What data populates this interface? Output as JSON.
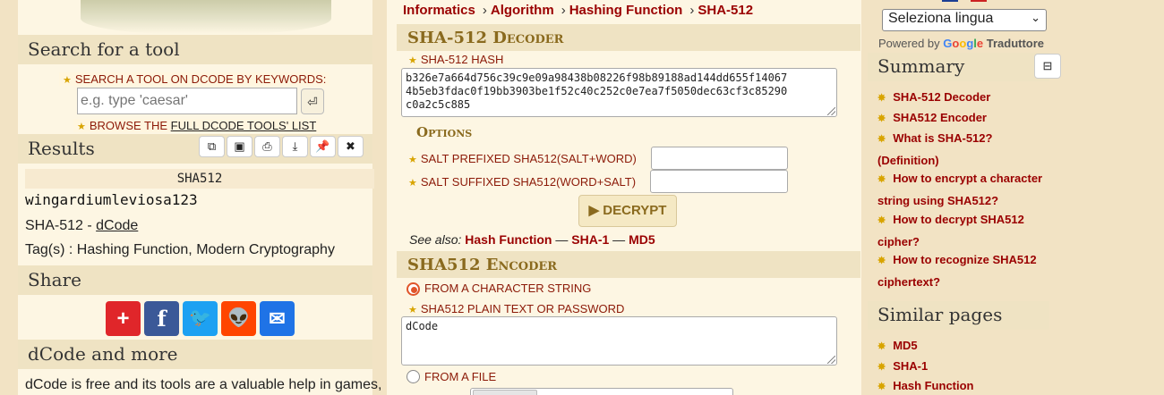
{
  "left": {
    "search_header": "Search for a tool",
    "kw_label": "SEARCH A TOOL ON DCODE BY KEYWORDS:",
    "search_placeholder": "e.g. type 'caesar'",
    "enter_glyph": "⏎",
    "browse_prefix": "BROWSE THE ",
    "browse_link": "FULL DCODE TOOLS' LIST",
    "results_header": "Results",
    "result_tools": [
      "copy-icon",
      "save-icon",
      "print-icon",
      "download-icon",
      "pin-icon",
      "close-icon"
    ],
    "result_label": "SHA512",
    "result_value": "wingardiumleviosa123",
    "source_prefix": "SHA-512 - ",
    "source_link": "dCode",
    "tags": "Tag(s) : Hashing Function, Modern Cryptography",
    "share_header": "Share",
    "share_buttons": [
      {
        "name": "addthis",
        "glyph": "+",
        "color": "#e0262a"
      },
      {
        "name": "facebook",
        "glyph": "f",
        "color": "#3b5998"
      },
      {
        "name": "twitter",
        "glyph": "🐦",
        "color": "#1da1f2"
      },
      {
        "name": "reddit",
        "glyph": "👽",
        "color": "#ff4500"
      },
      {
        "name": "email",
        "glyph": "✉",
        "color": "#1f73e6"
      }
    ],
    "more_header": "dCode and more",
    "more_text": "dCode is free and its tools are a valuable help in games,"
  },
  "middle": {
    "breadcrumb": [
      "Informatics",
      "Algorithm",
      "Hashing Function",
      "SHA-512"
    ],
    "decoder_title": "SHA-512 Decoder",
    "hash_label": "SHA-512 HASH",
    "hash_value": "b326e7a664d756c39c9e09a98438b08226f98b89188ad144dd655f14067\n4b5eb3fdac0f19bb3903be1f52c40c252c0e7ea7f5050dec63cf3c85290\nc0a2c5c885",
    "options_title": "Options",
    "salt_prefixed": "SALT PREFIXED SHA512(SALT+WORD)",
    "salt_suffixed": "SALT SUFFIXED SHA512(WORD+SALT)",
    "decrypt_label": "▶ DECRYPT",
    "see_also_prefix": "See also: ",
    "see_also": [
      "Hash Function",
      "SHA-1",
      "MD5"
    ],
    "encoder_title": "SHA512 Encoder",
    "from_string": "FROM A CHARACTER STRING",
    "plain_label": "SHA512 PLAIN TEXT OR PASSWORD",
    "plain_value": "dCode",
    "from_file": "FROM A FILE"
  },
  "right": {
    "language": "Seleziona lingua",
    "powered_by": "Powered by",
    "google": "Google",
    "translate": "Traduttore",
    "summary_header": "Summary",
    "summary_items": [
      "SHA-512 Decoder",
      "SHA512 Encoder",
      "What is SHA-512? (Definition)",
      "How to encrypt a character string using SHA512?",
      "How to decrypt SHA512 cipher?",
      "How to recognize SHA512 ciphertext?"
    ],
    "similar_header": "Similar pages",
    "similar_items": [
      "MD5",
      "SHA-1",
      "Hash Function"
    ]
  }
}
